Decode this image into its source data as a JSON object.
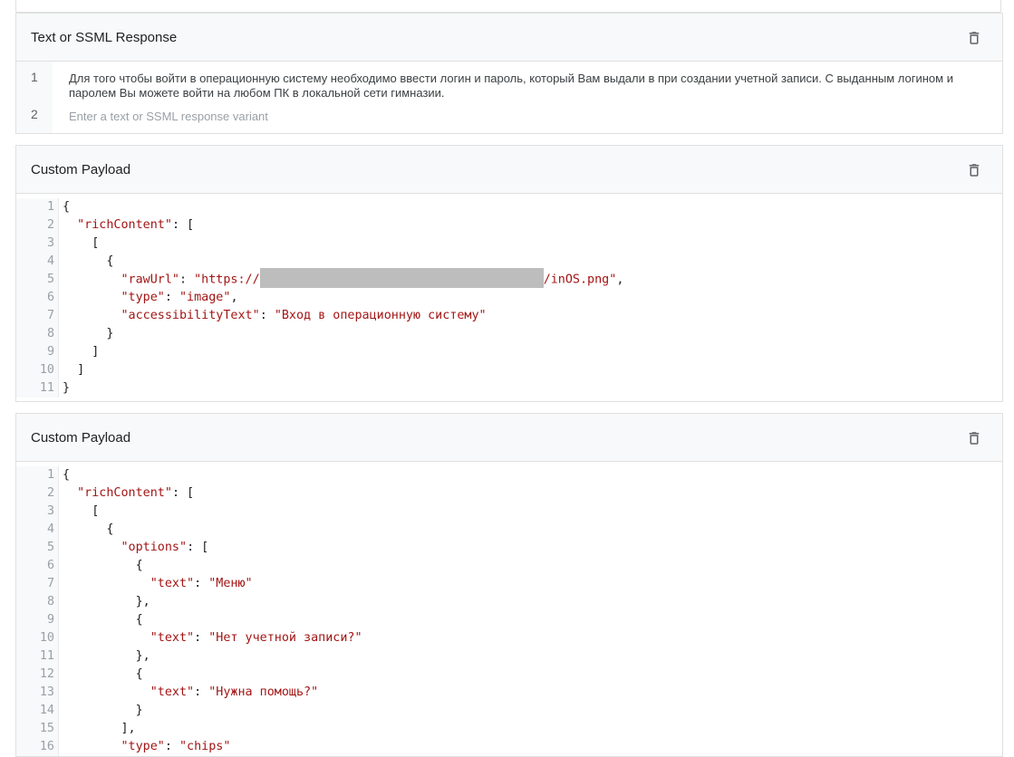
{
  "cards": [
    {
      "title": "Text or SSML Response",
      "rows": [
        {
          "num": "1",
          "text": "Для того чтобы войти в операционную систему необходимо ввести логин и пароль, который Вам выдали в при создании учетной записи. С выданным логином и паролем Вы можете войти на любом ПК в локальной сети гимназии."
        },
        {
          "num": "2",
          "placeholder": "Enter a text or SSML response variant"
        }
      ]
    },
    {
      "title": "Custom Payload",
      "lines": [
        "1",
        "2",
        "3",
        "4",
        "5",
        "6",
        "7",
        "8",
        "9",
        "10",
        "11"
      ],
      "code": {
        "richContent_key": "\"richContent\"",
        "rawUrl_key": "\"rawUrl\"",
        "rawUrl_prefix": "\"https://",
        "rawUrl_suffix": "/inOS.png\"",
        "type_key": "\"type\"",
        "type_val": "\"image\"",
        "acc_key": "\"accessibilityText\"",
        "acc_val": "\"Вход в операционную систему\""
      }
    },
    {
      "title": "Custom Payload",
      "lines": [
        "1",
        "2",
        "3",
        "4",
        "5",
        "6",
        "7",
        "8",
        "9",
        "10",
        "11",
        "12",
        "13",
        "14",
        "15",
        "16"
      ],
      "code": {
        "richContent_key": "\"richContent\"",
        "options_key": "\"options\"",
        "text_key": "\"text\"",
        "opt1": "\"Меню\"",
        "opt2": "\"Нет учетной записи?\"",
        "opt3": "\"Нужна помощь?\"",
        "type_key": "\"type\"",
        "type_val": "\"chips\""
      }
    }
  ],
  "icons": {
    "delete": "trash-icon"
  }
}
